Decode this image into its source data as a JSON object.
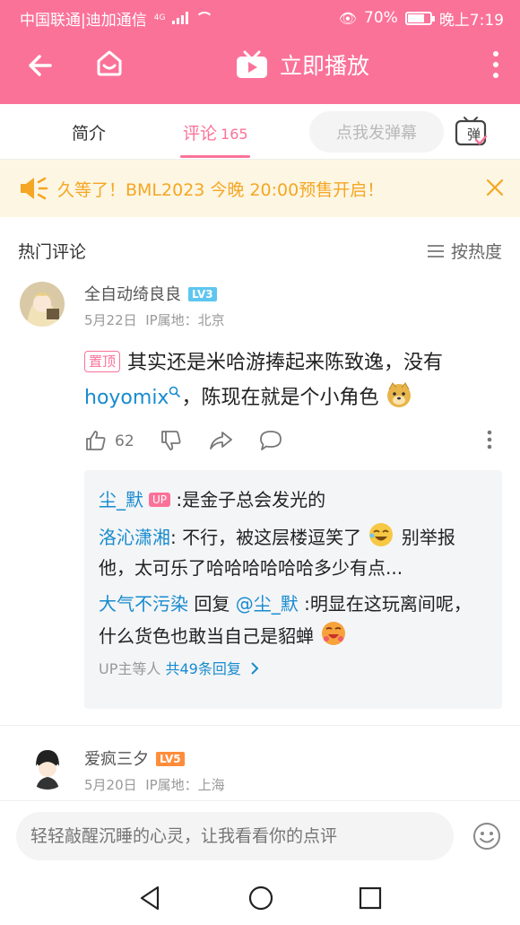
{
  "status_bar": {
    "carrier": "中国联通|迪加通信",
    "network": "4G",
    "battery": "70%",
    "time": "晚上7:19"
  },
  "header": {
    "title": "立即播放",
    "bg_color": "#fb7299"
  },
  "tabs": [
    {
      "label": "简介"
    },
    {
      "label": "评论",
      "count": "165"
    }
  ],
  "danmaku": {
    "placeholder": "点我发弹幕",
    "button_label": "弹"
  },
  "notice": {
    "text": "久等了！BML2023 今晚 20:00预售开启！"
  },
  "section": {
    "title": "热门评论",
    "sort_label": "按热度"
  },
  "comments": [
    {
      "user": "全自动绮良良",
      "level": "LV3",
      "date": "5月22日",
      "location": "IP属地：北京",
      "pinned_tag": "置顶",
      "text_before": "其实还是米哈游捧起来陈致逸，没有",
      "link": "hoyomix",
      "text_after": "，陈现在就是个小角色",
      "likes": "62",
      "replies": [
        {
          "user": "尘_默",
          "badge": "UP",
          "text": ":是金子总会发光的"
        },
        {
          "user": "洛沁潇湘",
          "text": ": 不行，被这层楼逗笑了",
          "text2": "别举报他，太可乐了哈哈哈哈哈哈多少有点..."
        },
        {
          "user": "大气不污染",
          "reply_word": "回复",
          "reply_to": "@尘_默",
          "text": ":明显在这玩离间呢，什么货色也敢当自己是貂蝉"
        }
      ],
      "reply_summary": "UP主等人",
      "reply_count_label": "共49条回复"
    },
    {
      "user": "爱疯三夕",
      "level": "LV5",
      "date": "5月20日",
      "location": "IP属地：上海"
    }
  ],
  "input": {
    "placeholder": "轻轻敲醒沉睡的心灵，让我看看你的点评"
  },
  "colors": {
    "accent": "#fb7299",
    "link": "#178bcf",
    "notice": "#f5a623"
  }
}
